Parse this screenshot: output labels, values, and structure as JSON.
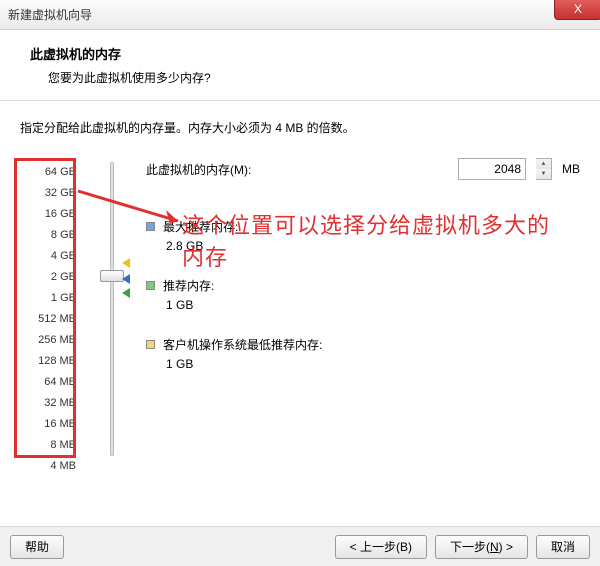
{
  "window": {
    "title": "新建虚拟机向导",
    "close": "X"
  },
  "header": {
    "title": "此虚拟机的内存",
    "subtitle": "您要为此虚拟机使用多少内存?"
  },
  "instruction": "指定分配给此虚拟机的内存量。内存大小必须为 4 MB 的倍数。",
  "scale": [
    "64 GB",
    "32 GB",
    "16 GB",
    "8 GB",
    "4 GB",
    "2 GB",
    "1 GB",
    "512 MB",
    "256 MB",
    "128 MB",
    "64 MB",
    "32 MB",
    "16 MB",
    "8 MB",
    "4 MB"
  ],
  "memory": {
    "label": "此虚拟机的内存(M):",
    "value": "2048",
    "unit": "MB"
  },
  "recs": {
    "max": {
      "label": "最大推荐内存:",
      "value": "2.8 GB"
    },
    "rec": {
      "label": "推荐内存:",
      "value": "1 GB"
    },
    "min": {
      "label": "客户机操作系统最低推荐内存:",
      "value": "1 GB"
    }
  },
  "annotation": "这个位置可以选择分给虚拟机多大的内存",
  "buttons": {
    "help": "帮助",
    "back": "< 上一步(B)",
    "next_pre": "下一步(",
    "next_key": "N",
    "next_post": ") >",
    "cancel": "取消"
  }
}
